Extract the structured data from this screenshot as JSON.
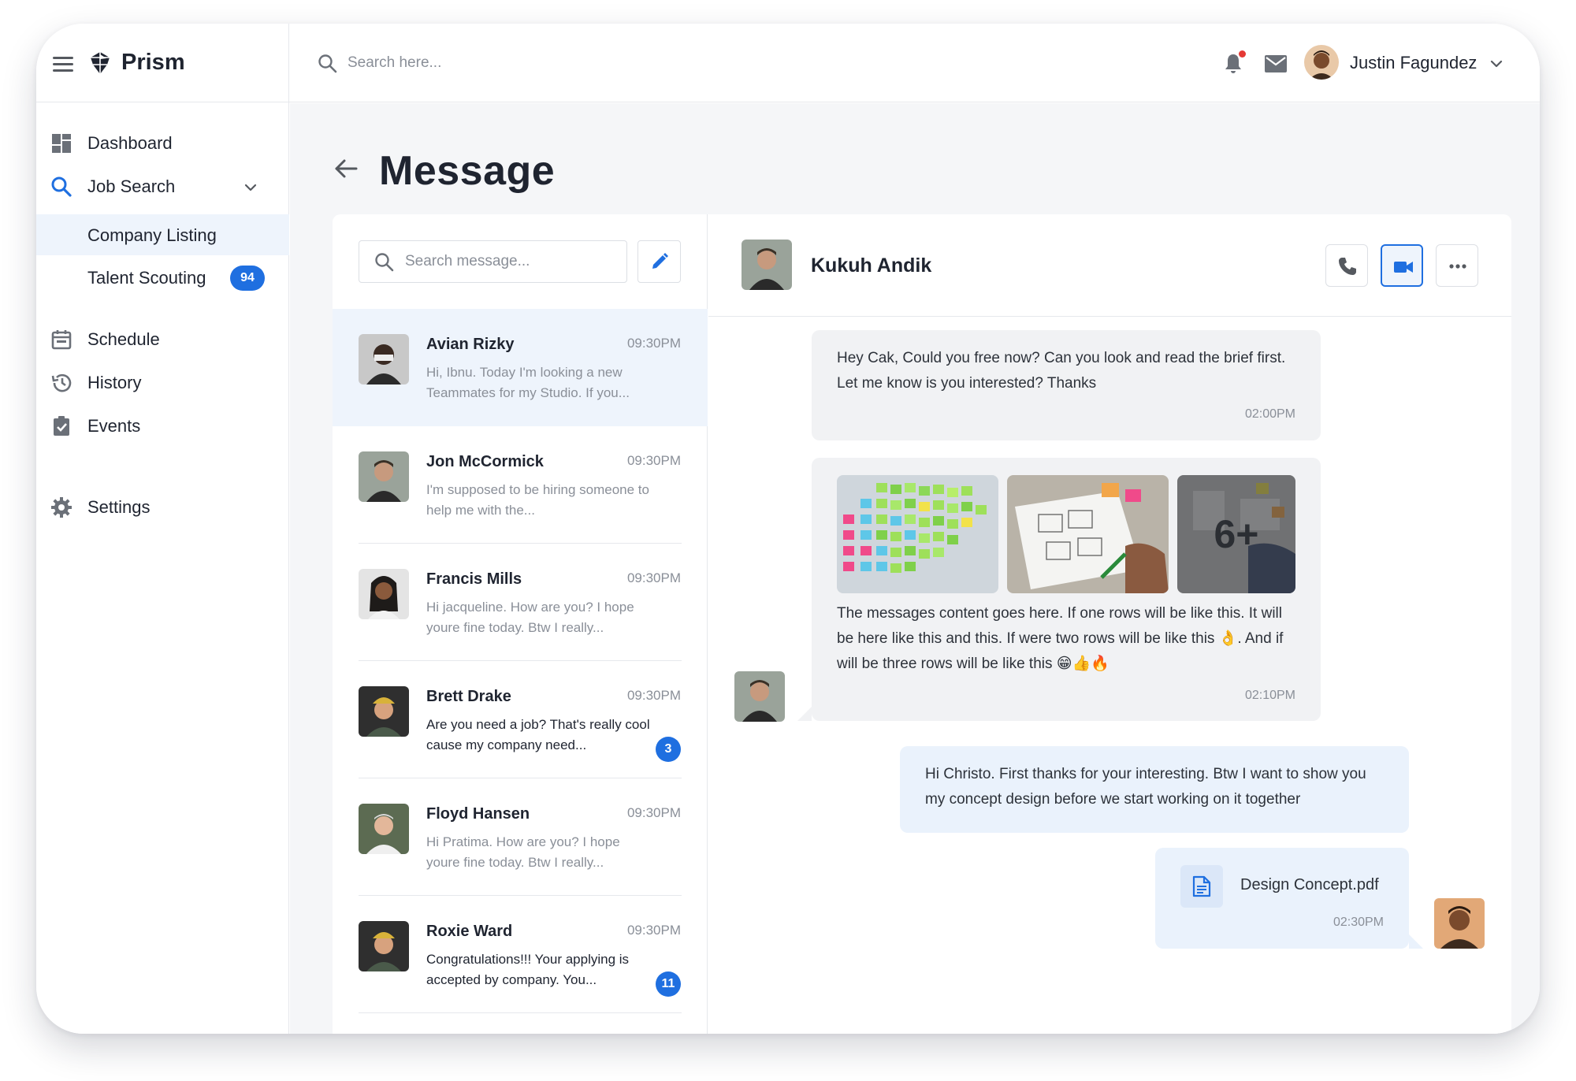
{
  "app": {
    "name": "Prism"
  },
  "sidebar": {
    "items": [
      {
        "label": "Dashboard"
      },
      {
        "label": "Job Search"
      },
      {
        "label": "Company Listing"
      },
      {
        "label": "Talent Scouting",
        "badge": "94"
      },
      {
        "label": "Schedule"
      },
      {
        "label": "History"
      },
      {
        "label": "Events"
      },
      {
        "label": "Settings"
      }
    ]
  },
  "topbar": {
    "search_placeholder": "Search here...",
    "user_name": "Justin Fagundez"
  },
  "page": {
    "title": "Message"
  },
  "messages": {
    "search_placeholder": "Search message...",
    "conversations": [
      {
        "name": "Avian Rizky",
        "time": "09:30PM",
        "preview": "Hi, Ibnu. Today I'm looking a new Teammates for my Studio. If you...",
        "unread": ""
      },
      {
        "name": "Jon McCormick",
        "time": "09:30PM",
        "preview": "I'm supposed to be hiring someone to help me with the...",
        "unread": ""
      },
      {
        "name": "Francis Mills",
        "time": "09:30PM",
        "preview": "Hi jacqueline. How are you? I hope youre fine today. Btw I really...",
        "unread": ""
      },
      {
        "name": "Brett Drake",
        "time": "09:30PM",
        "preview": "Are you need a job? That's really cool cause my company need...",
        "unread": "3"
      },
      {
        "name": "Floyd Hansen",
        "time": "09:30PM",
        "preview": "Hi Pratima. How are you? I hope youre fine today. Btw I really...",
        "unread": ""
      },
      {
        "name": "Roxie Ward",
        "time": "09:30PM",
        "preview": "Congratulations!!! Your applying is accepted by company. You...",
        "unread": "11"
      }
    ]
  },
  "chat": {
    "contact_name": "Kukuh Andik",
    "thread": [
      {
        "text": "Hey Cak, Could you free now? Can you look and read the brief first. Let me know is you interested? Thanks",
        "time": "02:00PM"
      },
      {
        "text": "The messages content goes here. If one rows will be like this. It will be here like this and this. If were two rows will be like this 👌. And if will be three rows will be like this 😁👍🔥",
        "time": "02:10PM",
        "more_photos": "6+"
      },
      {
        "text": "Hi Christo. First thanks for your interesting. Btw I want to show you my concept design before we start working on it together",
        "time": ""
      },
      {
        "file": "Design Concept.pdf",
        "time": "02:30PM"
      }
    ]
  },
  "colors": {
    "accent": "#1f6fe0",
    "selected_bg": "#eef4fc",
    "incoming_bubble": "#f1f2f4",
    "outgoing_bubble": "#eaf2fc",
    "notification_dot": "#e53935"
  },
  "icons": [
    "menu-icon",
    "prism-logo-icon",
    "dashboard-icon",
    "search-icon",
    "chevron-down-icon",
    "calendar-icon",
    "history-icon",
    "clipboard-check-icon",
    "gear-icon",
    "bell-icon",
    "mail-icon",
    "arrow-left-icon",
    "pencil-icon",
    "phone-icon",
    "video-icon",
    "more-horizontal-icon",
    "document-icon"
  ]
}
